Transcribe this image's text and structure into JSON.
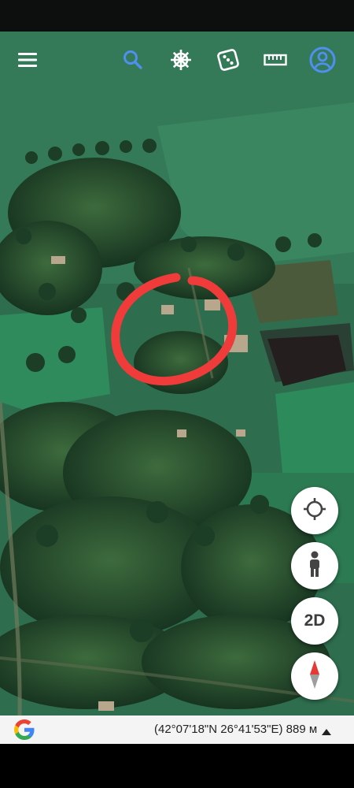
{
  "toolbar": {
    "menu_icon": "menu-icon",
    "search_icon": "search-icon",
    "voyager_icon": "ship-wheel-icon",
    "feeling_lucky_icon": "dice-icon",
    "measure_icon": "ruler-icon",
    "account_icon": "account-circle-icon",
    "accent_color": "#4f8ff0"
  },
  "map_controls": {
    "location_icon": "my-location-icon",
    "street_view_icon": "pegman-icon",
    "view_mode_label": "2D",
    "compass_icon": "compass-icon"
  },
  "annotation": {
    "color": "#f03b3b",
    "shape": "hand-drawn-circle"
  },
  "bottom_bar": {
    "logo": "google-g-logo",
    "coordinates": "(42°07'18\"N 26°41'53\"E) 889 м",
    "expand_icon": "caret-up-icon"
  }
}
